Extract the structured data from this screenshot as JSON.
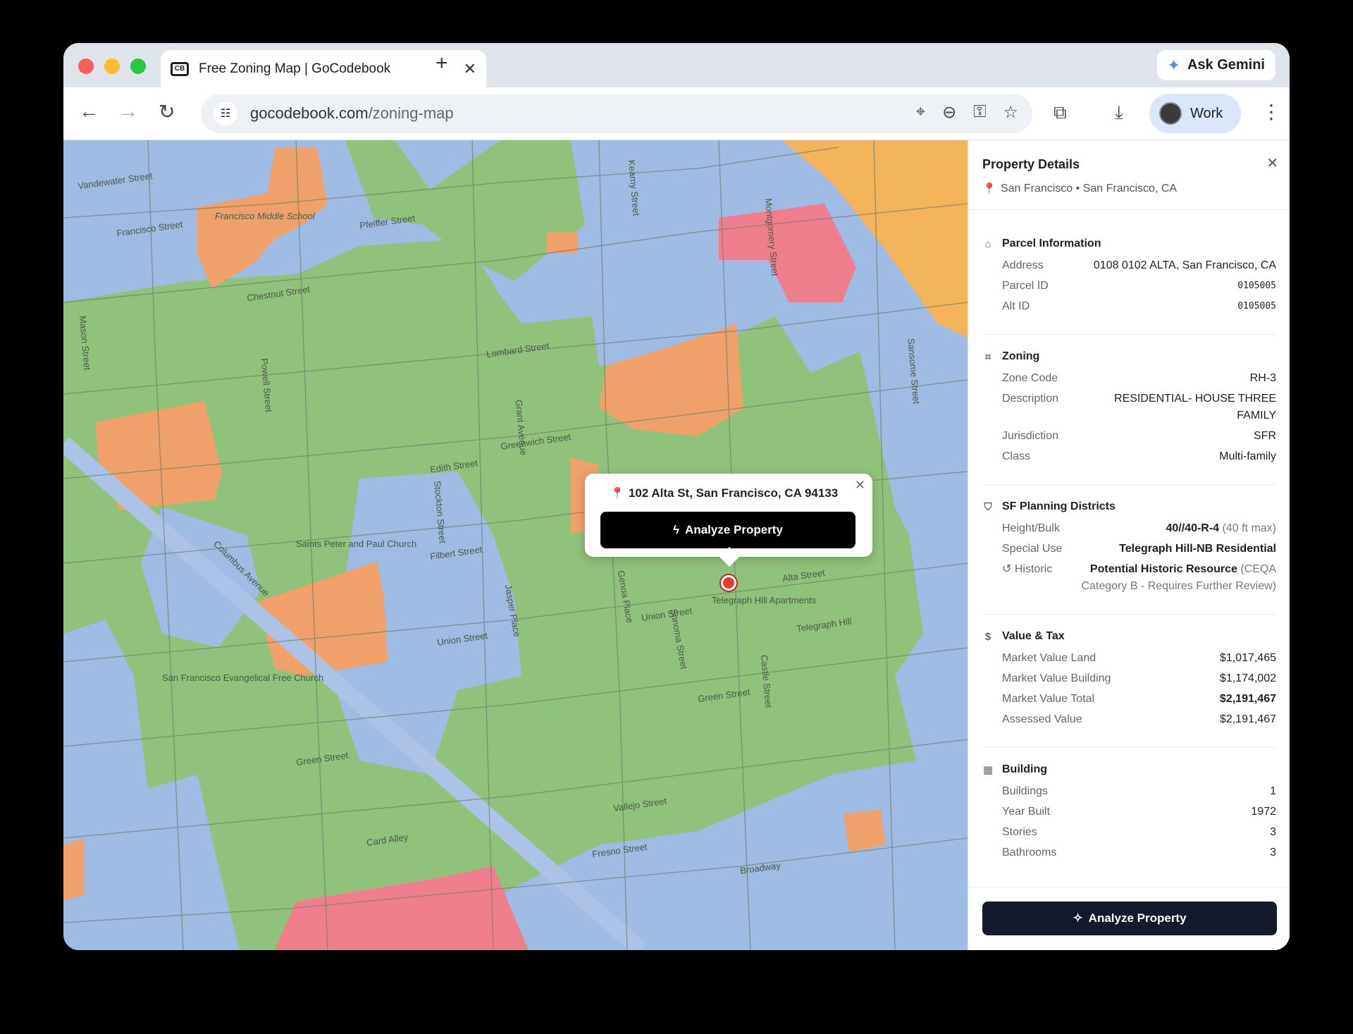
{
  "browser": {
    "tab_title": "Free Zoning Map | GoCodebook",
    "tab_favicon": "CB",
    "ask_gemini_label": "Ask Gemini",
    "url_host": "gocodebook.com",
    "url_path": "/zoning-map",
    "profile_label": "Work"
  },
  "map": {
    "street_labels": [
      "Francisco Street",
      "Chestnut Street",
      "Lombard Street",
      "Greenwich Street",
      "Filbert Street",
      "Union Street",
      "Green Street",
      "Vallejo Street",
      "Broadway",
      "Columbus Avenue",
      "Stockton Street",
      "Powell Street",
      "Grant Avenue",
      "Kearny Street",
      "Montgomery Street",
      "Sansome Street",
      "Alta Street",
      "Card Alley",
      "Fresno Street",
      "Edith Street",
      "Pfeiffer Street",
      "Jasper Place",
      "Genoa Place",
      "Sonoma Street",
      "Castle Street",
      "Mason Street",
      "Telegraph Hill",
      "Francisco Middle School",
      "Saints Peter and Paul Church",
      "San Francisco Evangelical Free Church",
      "Telegraph Hill Apartments",
      "Vandewater Street",
      "Union Street",
      "Green Street"
    ],
    "popup": {
      "address": "102 Alta St, San Francisco, CA 94133",
      "button_label": "Analyze Property"
    },
    "zone_colors": {
      "residential": "#8fc27a",
      "commercial": "#8fb3e0",
      "public": "#f0a069",
      "mixed": "#f07f8e",
      "industrial": "#f2b35a"
    }
  },
  "panel": {
    "title": "Property Details",
    "location": "San Francisco • San Francisco, CA",
    "sections": {
      "parcel": {
        "title": "Parcel Information",
        "address_label": "Address",
        "address": "0108 0102 ALTA, San Francisco, CA",
        "parcel_id_label": "Parcel ID",
        "parcel_id": "0105005",
        "alt_id_label": "Alt ID",
        "alt_id": "0105005"
      },
      "zoning": {
        "title": "Zoning",
        "zone_code_label": "Zone Code",
        "zone_code": "RH-3",
        "description_label": "Description",
        "description": "RESIDENTIAL- HOUSE THREE FAMILY",
        "jurisdiction_label": "Jurisdiction",
        "jurisdiction": "SFR",
        "class_label": "Class",
        "class": "Multi-family"
      },
      "planning": {
        "title": "SF Planning Districts",
        "height_label": "Height/Bulk",
        "height": "40//40-R-4",
        "height_note": "(40 ft max)",
        "special_use_label": "Special Use",
        "special_use": "Telegraph Hill-NB Residential",
        "historic_label": "Historic",
        "historic": "Potential Historic Resource",
        "historic_note": "(CEQA Category B - Requires Further Review)"
      },
      "value": {
        "title": "Value & Tax",
        "land_label": "Market Value Land",
        "land": "$1,017,465",
        "building_label": "Market Value Building",
        "building": "$1,174,002",
        "total_label": "Market Value Total",
        "total": "$2,191,467",
        "assessed_label": "Assessed Value",
        "assessed": "$2,191,467"
      },
      "building": {
        "title": "Building",
        "buildings_label": "Buildings",
        "buildings": "1",
        "year_label": "Year Built",
        "year": "1972",
        "stories_label": "Stories",
        "stories": "3",
        "bathrooms_label": "Bathrooms",
        "bathrooms": "3"
      }
    },
    "footer_button": "Analyze Property"
  }
}
